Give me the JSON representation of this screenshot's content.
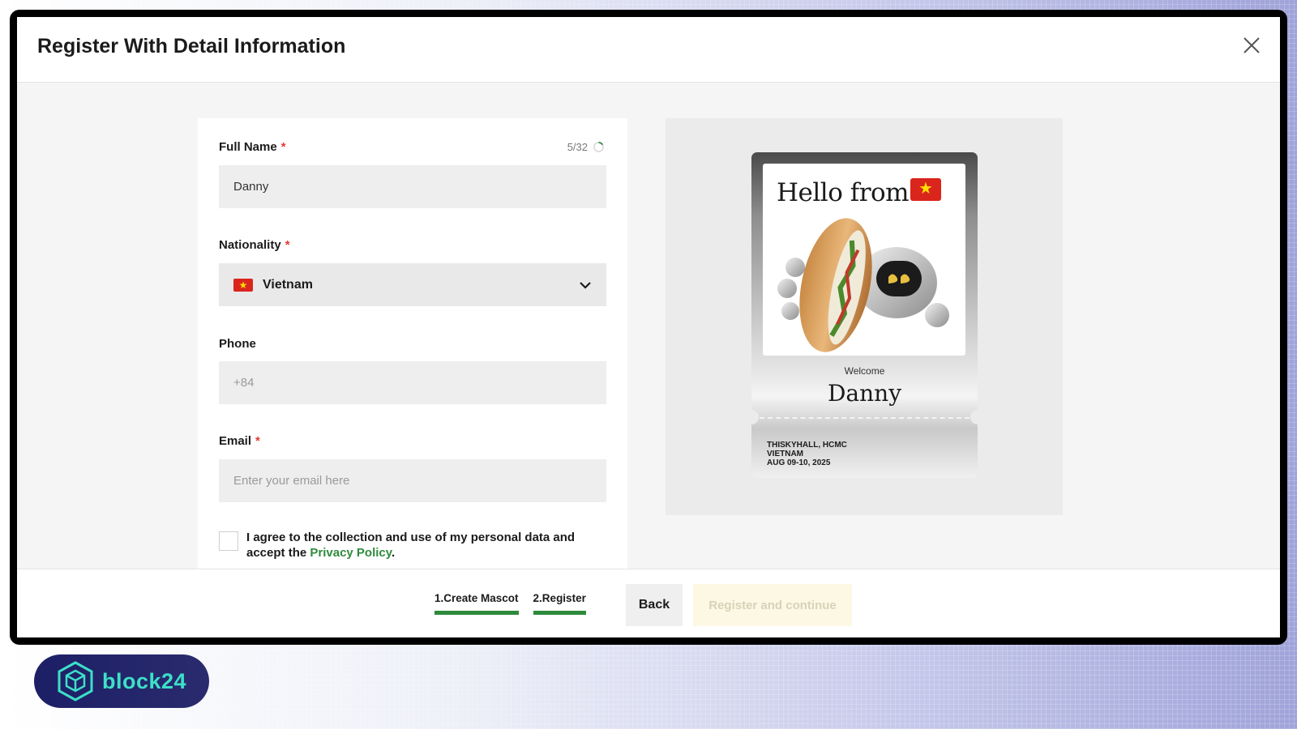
{
  "modal": {
    "title": "Register With Detail Information"
  },
  "form": {
    "full_name": {
      "label": "Full Name",
      "required_mark": "*",
      "value": "Danny",
      "counter": "5/32"
    },
    "nationality": {
      "label": "Nationality",
      "required_mark": "*",
      "selected": "Vietnam",
      "flag_icon": "vietnam-flag-icon"
    },
    "phone": {
      "label": "Phone",
      "placeholder": "+84"
    },
    "email": {
      "label": "Email",
      "required_mark": "*",
      "placeholder": "Enter your email here"
    },
    "consent": {
      "text": "I agree to the collection and use of my personal data and accept the",
      "link": "Privacy Policy",
      "suffix": ".",
      "checked": false
    }
  },
  "ticket": {
    "heading": "Hello from",
    "welcome": "Welcome",
    "name": "Danny",
    "venue": "THISKYHALL, HCMC",
    "country": "VIETNAM",
    "dates": "AUG 09-10, 2025"
  },
  "footer": {
    "steps": [
      "1.Create Mascot",
      "2.Register"
    ],
    "back_label": "Back",
    "register_label": "Register and continue"
  },
  "brand": {
    "name": "block24"
  },
  "colors": {
    "accent_green": "#2e8b3c",
    "required_red": "#e53935",
    "disabled_button_bg": "#fdf8e3",
    "brand_teal": "#3ce0c8",
    "brand_navy": "#1d1f66"
  }
}
